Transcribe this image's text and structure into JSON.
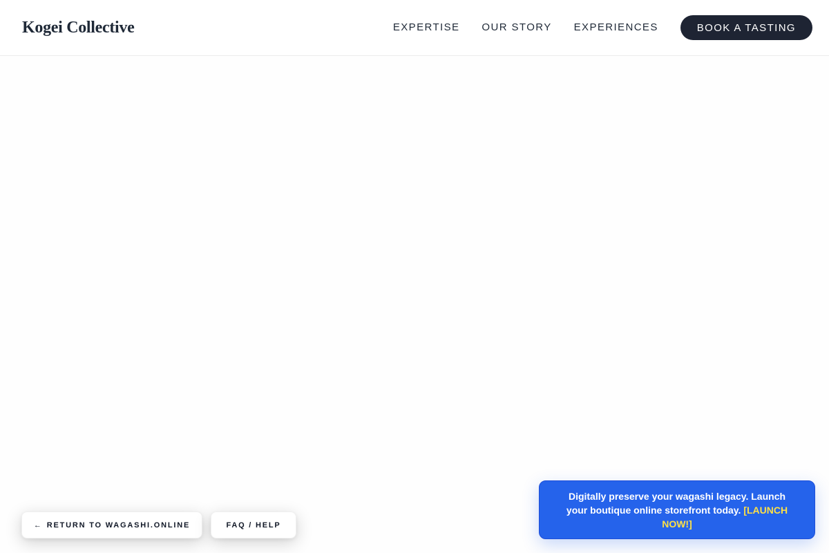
{
  "header": {
    "brand": "Kogei Collective",
    "nav": [
      {
        "label": "EXPERTISE"
      },
      {
        "label": "OUR STORY"
      },
      {
        "label": "EXPERIENCES"
      }
    ],
    "cta_label": "BOOK A TASTING"
  },
  "floating_buttons": {
    "return_arrow": "←",
    "return_label": "RETURN TO WAGASHI.ONLINE",
    "faq_label": "FAQ / HELP"
  },
  "promo": {
    "message": "Digitally preserve your wagashi legacy. Launch your boutique online storefront today. ",
    "link_label": "[LAUNCH NOW!]"
  },
  "colors": {
    "brand_dark": "#1e2433",
    "promo_blue": "#2563eb",
    "promo_link": "#fde047"
  }
}
